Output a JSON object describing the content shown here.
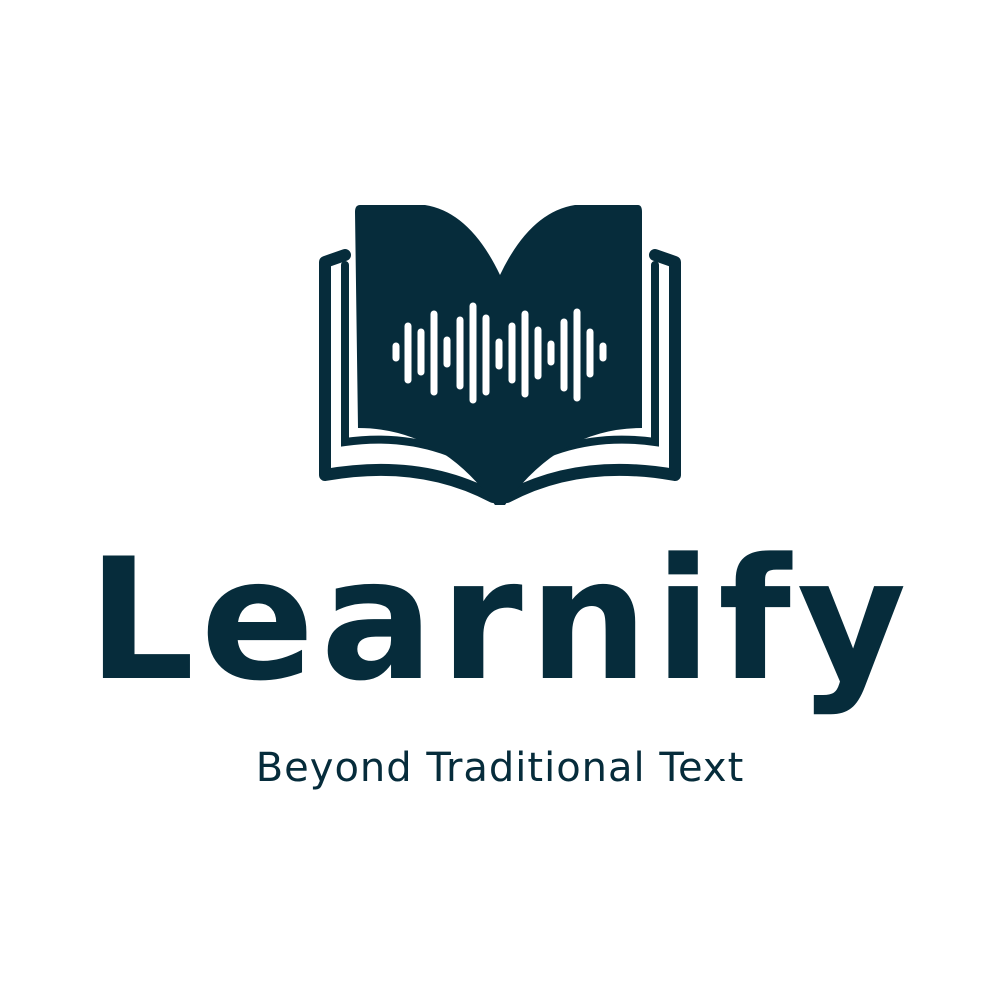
{
  "brand": {
    "name": "Learnify",
    "tagline": "Beyond Traditional Text"
  },
  "logo": {
    "icon": "open-book-soundwave-icon",
    "primary_color": "#062c3b",
    "background_color": "#ffffff"
  }
}
